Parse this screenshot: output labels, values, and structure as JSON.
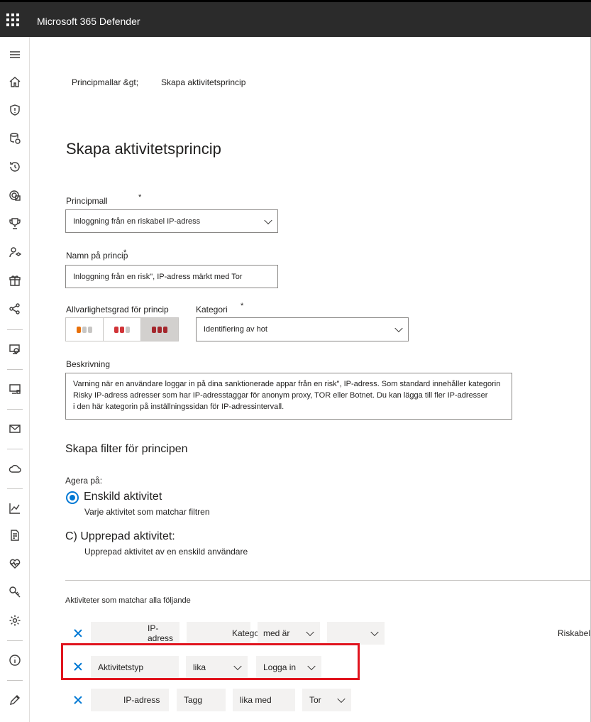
{
  "app": {
    "title": "Microsoft 365 Defender"
  },
  "nav": {
    "icons": [
      "menu-icon",
      "home-icon",
      "shield-icon",
      "incidents-icon",
      "hunting-icon",
      "threat-analytics-icon",
      "secure-score-icon",
      "learning-hub-icon",
      "trials-icon",
      "partners-icon",
      "assets-icon",
      "endpoints-icon",
      "email-icon",
      "cloud-apps-icon",
      "reports-icon",
      "audit-icon",
      "health-icon",
      "permissions-icon",
      "settings-icon",
      "info-icon",
      "customize-icon"
    ]
  },
  "breadcrumb": {
    "parent": "Principmallar &gt;",
    "current": "Skapa aktivitetsprincip"
  },
  "page": {
    "title": "Skapa aktivitetsprincip"
  },
  "form": {
    "template_label": "Principmall",
    "required_mark": "*",
    "template_value": "Inloggning från en riskabel IP-adress",
    "name_label": "Namn på princip",
    "name_value": "Inloggning från en risk\", IP-adress märkt med Tor",
    "severity_label": "Allvarlighetsgrad för princip",
    "category_label": "Kategori",
    "category_value": "Identifiering av hot",
    "description_label": "Beskrivning",
    "description_lines": [
      "Varning när en användare loggar in på dina sanktionerade appar från en risk\", IP-adress. Som standard innehåller kategorin",
      "Risky IP-adress adresser som har IP-adresstaggar för anonym proxy, TOR eller Botnet. Du kan lägga till fler IP-adresser",
      "i den här kategorin på inställningssidan för IP-adressintervall."
    ]
  },
  "severity": {
    "selected": "high",
    "colors": {
      "low_accent": "#e8700a",
      "medium_accent": "#d13438",
      "high_accent": "#a4262c",
      "grey": "#c8c6c4"
    }
  },
  "filters": {
    "heading": "Skapa filter för principen",
    "act_on_label": "Agera på:",
    "single_title": "Enskild aktivitet",
    "single_sub": "Varje aktivitet som matchar filtren",
    "repeated_title": "C) Upprepad aktivitet:",
    "repeated_sub": "Upprepad aktivitet av en enskild användare",
    "match_label": "Aktiviteter som matchar alla följande",
    "row1": {
      "field": "IP-adress",
      "sub": "Kategori",
      "op": "med är",
      "trailing": "Riskabel"
    },
    "row2": {
      "field": "Aktivitetstyp",
      "op": "lika",
      "value": "Logga in"
    },
    "row3": {
      "field": "IP-adress",
      "sub": "Tagg",
      "op": "lika med",
      "value": "Tor"
    }
  },
  "accent_color": "#0078d4",
  "highlight_color": "#e0141e"
}
